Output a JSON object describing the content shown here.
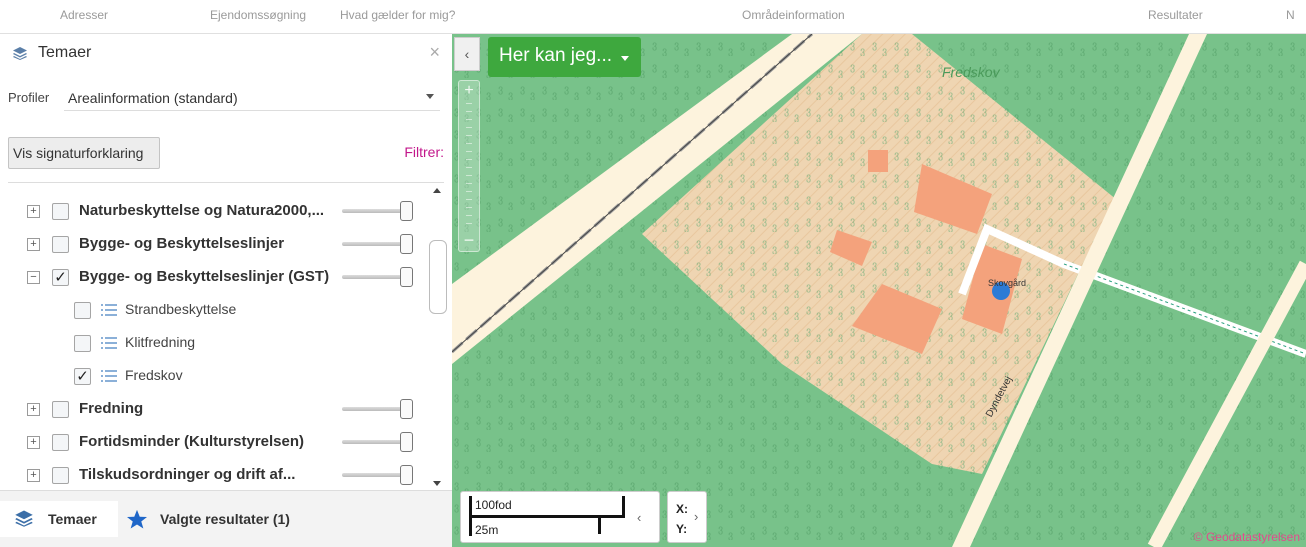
{
  "topnav": {
    "items": [
      "Adresser",
      "Ejendomssøgning",
      "Hvad gælder for mig?",
      "Områdeinformation",
      "Resultater",
      "N"
    ]
  },
  "sidebar": {
    "header": {
      "title": "Temaer",
      "close": "×"
    },
    "profile": {
      "label": "Profiler",
      "value": "Arealinformation (standard)"
    },
    "legend_button": "Vis signaturforklaring",
    "filter_label": "Filtrer:",
    "layers": [
      {
        "expander": "+",
        "checked": false,
        "label": "Naturbeskyttelse og Natura2000,...",
        "slider_level": 1.0
      },
      {
        "expander": "+",
        "checked": false,
        "label": "Bygge- og Beskyttelseslinjer",
        "slider_level": 1.0
      },
      {
        "expander": "−",
        "checked": true,
        "label": "Bygge- og Beskyttelseslinjer (GST)",
        "slider_level": 1.0
      },
      {
        "sublayer": true,
        "checked": false,
        "label": "Strandbeskyttelse"
      },
      {
        "sublayer": true,
        "checked": false,
        "label": "Klitfredning"
      },
      {
        "sublayer": true,
        "checked": true,
        "label": "Fredskov"
      },
      {
        "expander": "+",
        "checked": false,
        "label": "Fredning",
        "slider_level": 1.0
      },
      {
        "expander": "+",
        "checked": false,
        "label": "Fortidsminder (Kulturstyrelsen)",
        "slider_level": 1.0
      },
      {
        "expander": "+",
        "checked": false,
        "label": "Tilskudsordninger og drift af...",
        "slider_level": 1.0
      }
    ],
    "tabs": {
      "temaer": "Temaer",
      "valgte": "Valgte resultater (1)"
    }
  },
  "map": {
    "menu_button": "Her kan jeg...",
    "collapse": "‹",
    "zoom_in": "+",
    "zoom_out": "−",
    "scale": {
      "imperial": "100fod",
      "metric": "25m",
      "prev": "‹"
    },
    "coords": {
      "x_label": "X:",
      "y_label": "Y:",
      "next": "›"
    },
    "places": {
      "fredskov": "Fredskov",
      "skovgard": "Skovgård",
      "road": "Dyndetvej"
    },
    "copyright": "© Geodatastyrelsen",
    "colors": {
      "forest": "#78c28a",
      "hatch": "#f5d6b4",
      "building": "#f4a27c",
      "road": "#fdf3dd",
      "marker": "#2c7bd6",
      "menu_button": "#3ea83e"
    }
  }
}
